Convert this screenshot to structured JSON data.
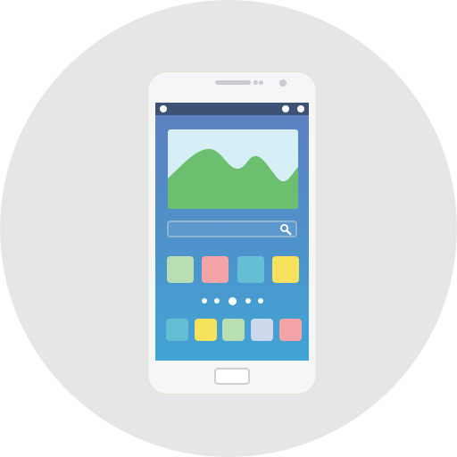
{
  "colors": {
    "background_circle": "#e6e6e8",
    "phone_body": "#f5f6f7",
    "speaker": "#c9cbcf",
    "camera": "#c9cbcf",
    "status_bar": "#3e5275",
    "screen_top": "#5e7ec0",
    "screen_bottom": "#41a4d4",
    "photo_sky": "#d6eef6",
    "photo_hills": "#6bbf6e",
    "search_icon": "#ffffff"
  },
  "icons": {
    "search": "magnifier-icon",
    "photo": "landscape-image-icon",
    "home": "home-button-icon"
  },
  "home_screen": {
    "app_row": [
      {
        "name": "app-1",
        "color": "#b8dfb4"
      },
      {
        "name": "app-2",
        "color": "#f4a4a6"
      },
      {
        "name": "app-3",
        "color": "#64bfd5"
      },
      {
        "name": "app-4",
        "color": "#f6e25c"
      }
    ],
    "page_indicator": {
      "count": 5,
      "active_index": 2
    },
    "dock": [
      {
        "name": "dock-1",
        "color": "#64bfd5"
      },
      {
        "name": "dock-2",
        "color": "#f6e25c"
      },
      {
        "name": "dock-3",
        "color": "#b8dfb4"
      },
      {
        "name": "dock-4",
        "color": "#cdd8ec"
      },
      {
        "name": "dock-5",
        "color": "#f4a4a6"
      }
    ]
  }
}
